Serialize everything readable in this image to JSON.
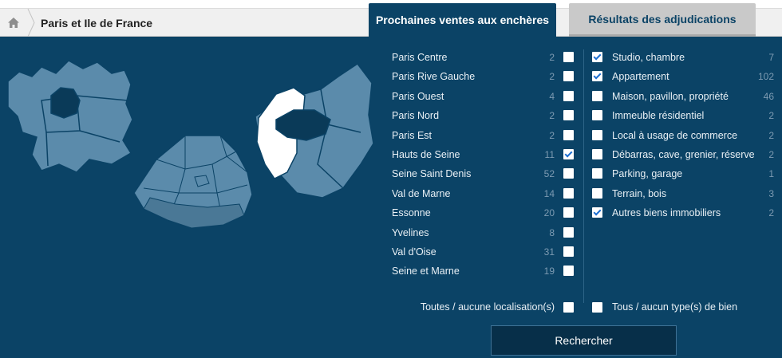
{
  "breadcrumb": {
    "label": "Paris et Ile de France"
  },
  "tabs": {
    "active": "Prochaines ventes aux enchères",
    "inactive": "Résultats des adjudications"
  },
  "locations": [
    {
      "label": "Paris Centre",
      "count": "2",
      "checked": false
    },
    {
      "label": "Paris Rive Gauche",
      "count": "2",
      "checked": false
    },
    {
      "label": "Paris Ouest",
      "count": "4",
      "checked": false
    },
    {
      "label": "Paris Nord",
      "count": "2",
      "checked": false
    },
    {
      "label": "Paris Est",
      "count": "2",
      "checked": false
    },
    {
      "label": "Hauts de Seine",
      "count": "11",
      "checked": true
    },
    {
      "label": "Seine Saint Denis",
      "count": "52",
      "checked": false
    },
    {
      "label": "Val de Marne",
      "count": "14",
      "checked": false
    },
    {
      "label": "Essonne",
      "count": "20",
      "checked": false
    },
    {
      "label": "Yvelines",
      "count": "8",
      "checked": false
    },
    {
      "label": "Val d'Oise",
      "count": "31",
      "checked": false
    },
    {
      "label": "Seine et Marne",
      "count": "19",
      "checked": false
    }
  ],
  "types": [
    {
      "label": "Studio, chambre",
      "count": "7",
      "checked": true
    },
    {
      "label": "Appartement",
      "count": "102",
      "checked": true
    },
    {
      "label": "Maison, pavillon, propriété",
      "count": "46",
      "checked": false
    },
    {
      "label": "Immeuble résidentiel",
      "count": "2",
      "checked": false
    },
    {
      "label": "Local à usage de commerce",
      "count": "2",
      "checked": false
    },
    {
      "label": "Débarras, cave, grenier, réserve",
      "count": "2",
      "checked": false
    },
    {
      "label": "Parking, garage",
      "count": "1",
      "checked": false
    },
    {
      "label": "Terrain, bois",
      "count": "3",
      "checked": false
    },
    {
      "label": "Autres biens immobiliers",
      "count": "2",
      "checked": true
    }
  ],
  "all_locations": {
    "label": "Toutes / aucune localisation(s)",
    "checked": false
  },
  "all_types": {
    "label": "Tous / aucun type(s) de bien",
    "checked": false
  },
  "search_button": "Rechercher",
  "colors": {
    "panel": "#0b4366",
    "map_region": "#5b8bab",
    "map_selected": "#ffffff",
    "map_dark": "#0a3a58",
    "checkbox_check": "#1d6fd1"
  },
  "icons": {
    "home": "home-icon"
  }
}
